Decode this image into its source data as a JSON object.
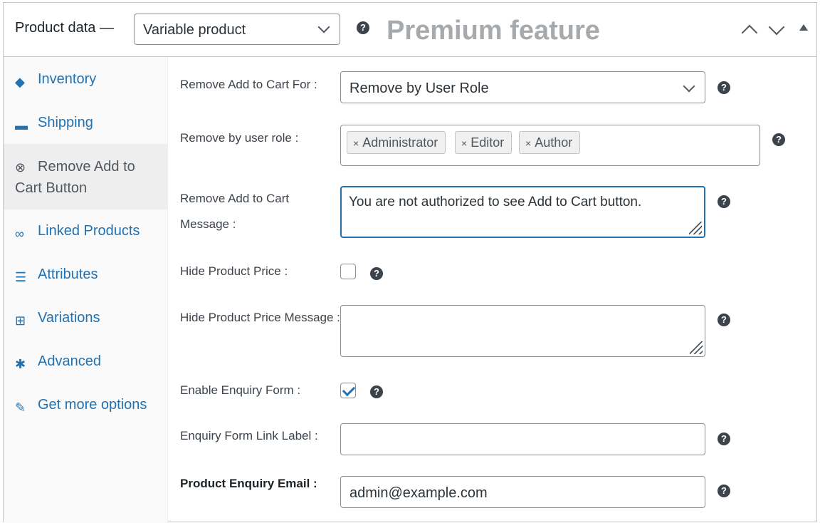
{
  "header": {
    "title": "Product data —",
    "product_type": "Variable product",
    "premium_label": "Premium feature"
  },
  "sidebar": {
    "items": [
      {
        "label": "Inventory",
        "icon": "tag-icon"
      },
      {
        "label": "Shipping",
        "icon": "truck-icon"
      },
      {
        "label": "Remove Add to Cart Button",
        "icon": "close-circle-icon"
      },
      {
        "label": "Linked Products",
        "icon": "link-icon"
      },
      {
        "label": "Attributes",
        "icon": "list-icon"
      },
      {
        "label": "Variations",
        "icon": "grid-icon"
      },
      {
        "label": "Advanced",
        "icon": "gear-icon"
      },
      {
        "label": "Get more options",
        "icon": "plugin-icon"
      }
    ]
  },
  "form": {
    "remove_for_label": "Remove Add to Cart For :",
    "remove_for_value": "Remove by User Role",
    "user_role_label": "Remove by user role :",
    "user_roles": [
      "Administrator",
      "Editor",
      "Author"
    ],
    "message_label": "Remove Add to Cart Message :",
    "message_value": "You are not authorized to see Add to Cart button.",
    "hide_price_label": "Hide Product Price :",
    "hide_price_checked": false,
    "hide_price_msg_label": "Hide Product Price Message :",
    "hide_price_msg_value": "",
    "enquiry_label": "Enable Enquiry Form :",
    "enquiry_checked": true,
    "enquiry_link_label": "Enquiry Form Link Label :",
    "enquiry_link_value": "",
    "enquiry_email_label": "Product Enquiry Email :",
    "enquiry_email_value": "admin@example.com"
  },
  "colors": {
    "accent": "#2271b1",
    "premium": "#a7aaad"
  }
}
